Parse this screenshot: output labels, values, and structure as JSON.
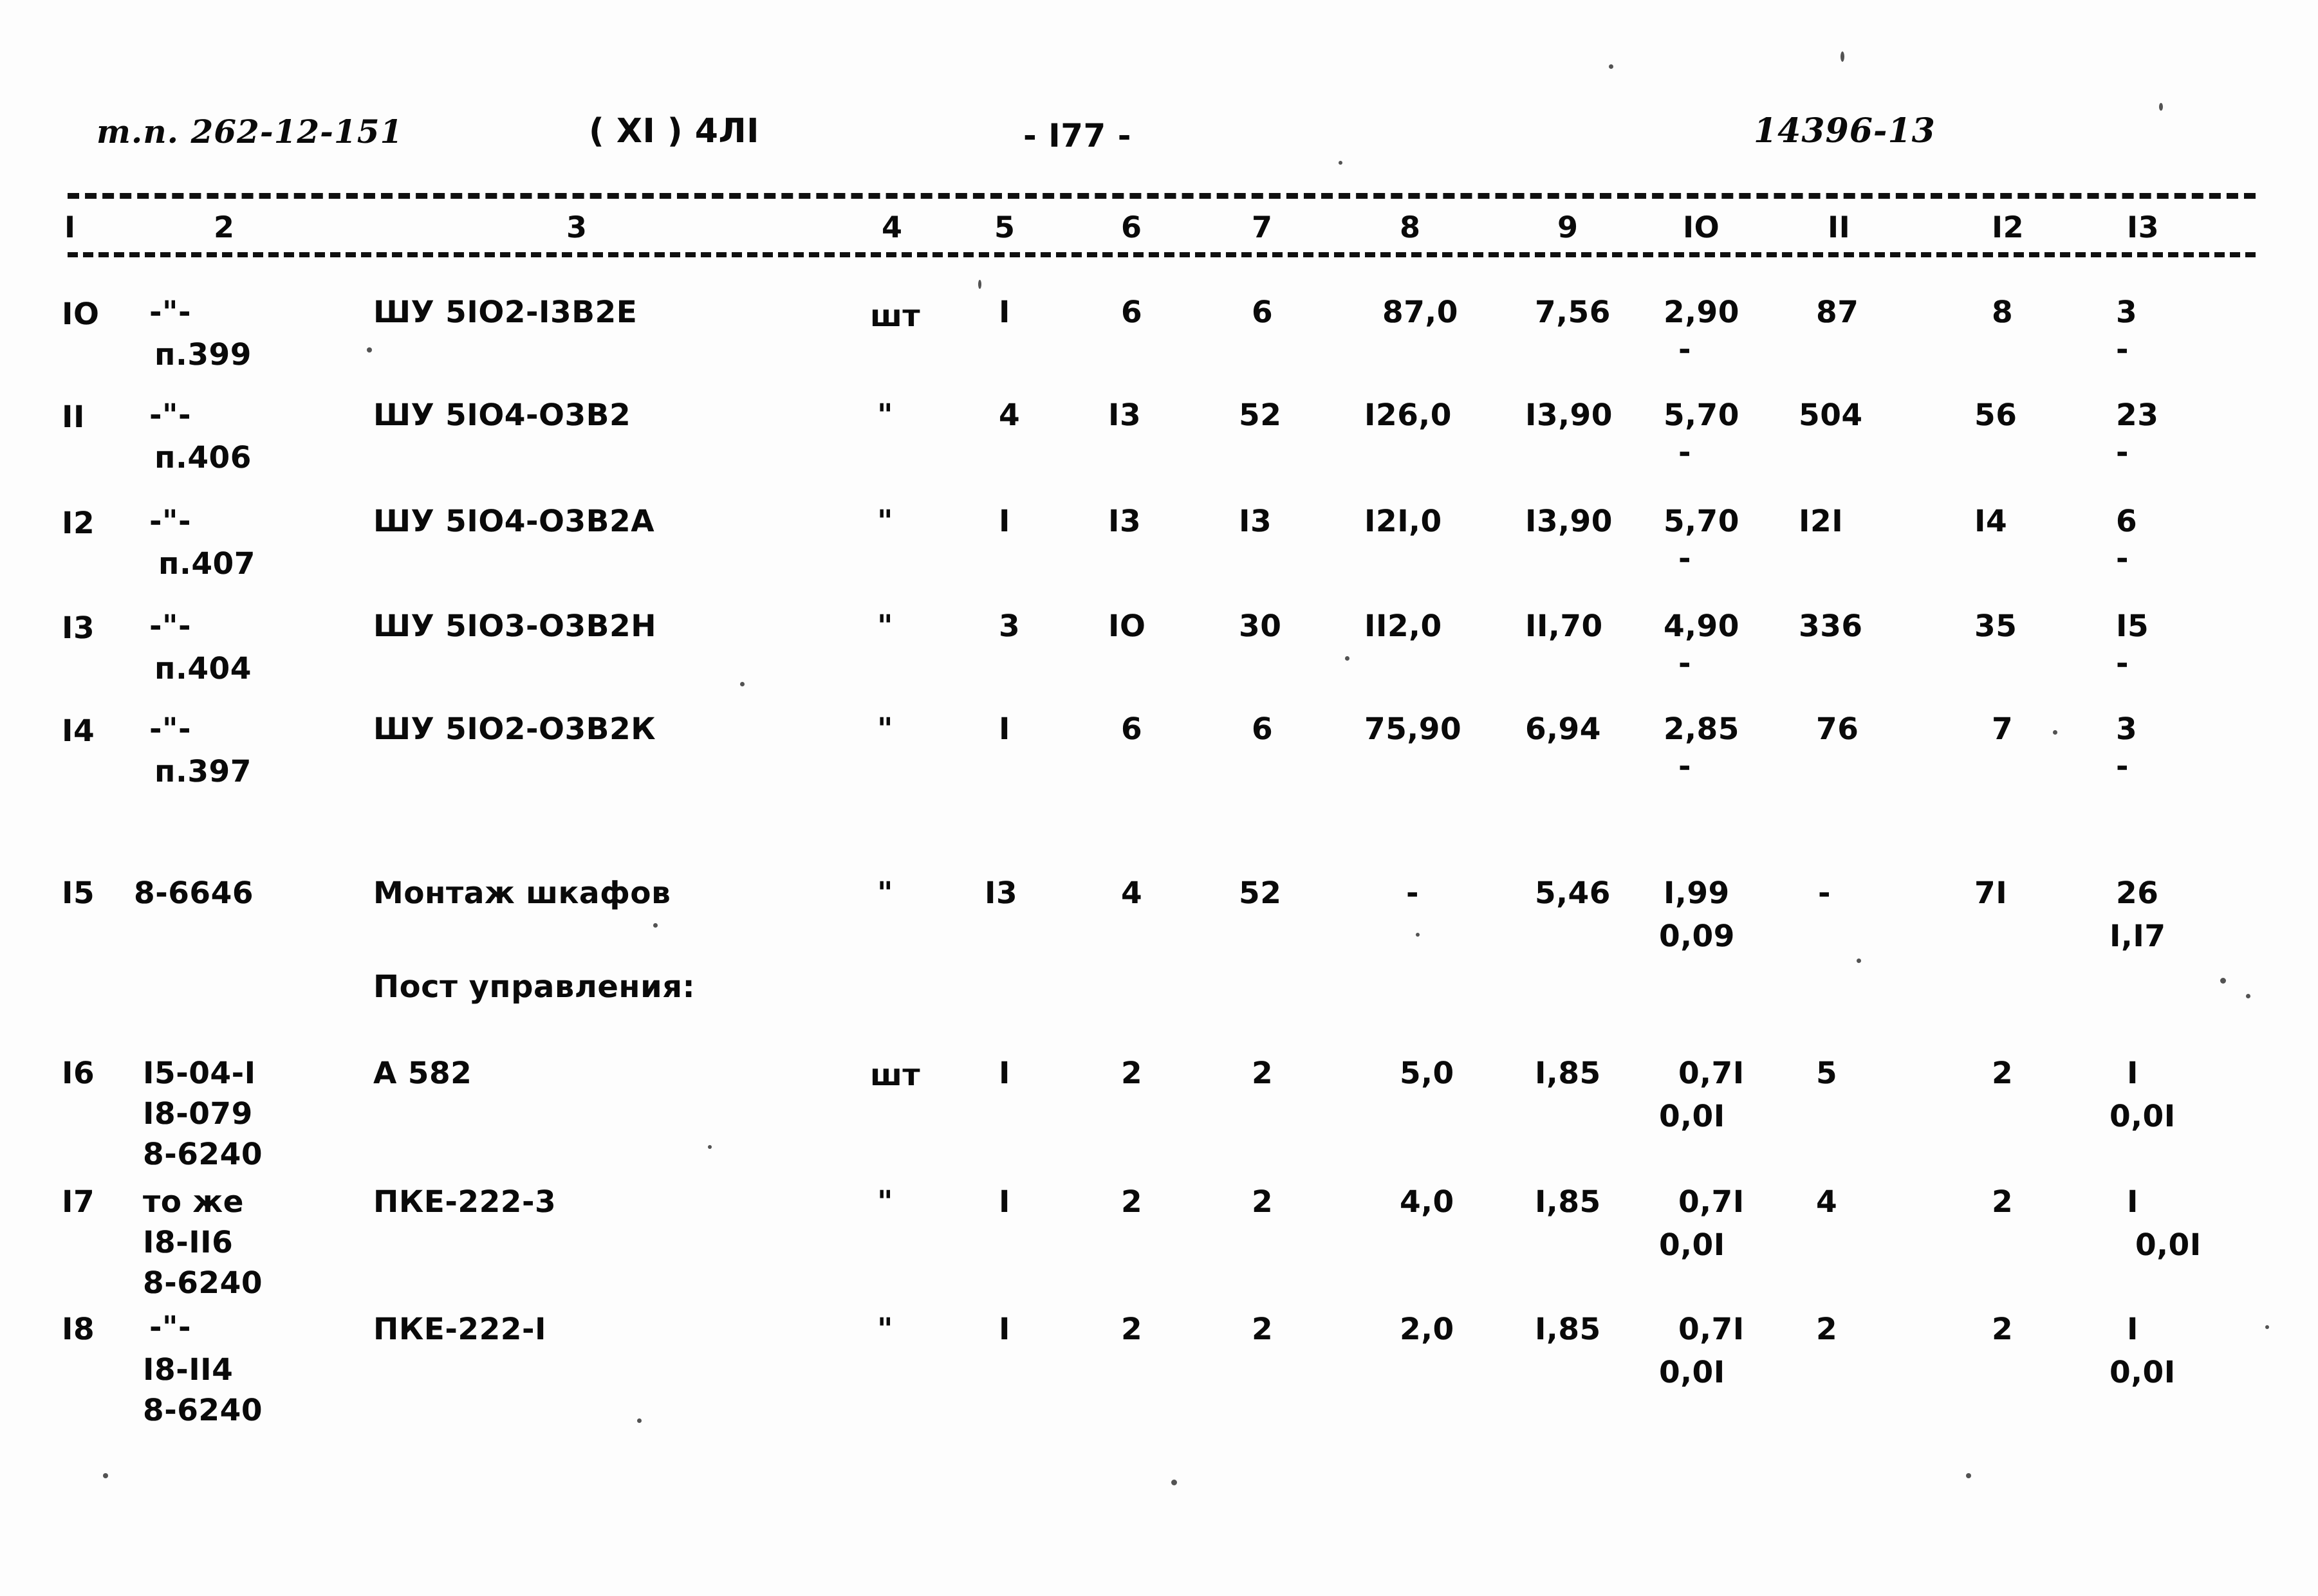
{
  "page": {
    "doc_code": "т.п. 262-12-151",
    "album": "( ХI ) 4ЛI",
    "page_number": "- I77 -",
    "stamp": "14396-13"
  },
  "table": {
    "column_headers": [
      "I",
      "2",
      "3",
      "4",
      "5",
      "6",
      "7",
      "8",
      "9",
      "IO",
      "II",
      "I2",
      "I3"
    ],
    "section_label": "Пост управления:",
    "rows": [
      {
        "c1": "IO",
        "c2_line1": "-\"-",
        "c2_line2": "п.399",
        "c3": "ШУ 5IО2-I3В2Е",
        "c4": "шт",
        "c5": "I",
        "c6": "6",
        "c7": "6",
        "c8": "87,0",
        "c9": "7,56",
        "c10": "2,90",
        "c10b": "-",
        "c11": "87",
        "c12": "8",
        "c13": "3",
        "c13b": "-"
      },
      {
        "c1": "II",
        "c2_line1": "-\"-",
        "c2_line2": "п.406",
        "c3": "ШУ 5IО4-О3В2",
        "c4": "\"",
        "c5": "4",
        "c6": "I3",
        "c7": "52",
        "c8": "I26,0",
        "c9": "I3,90",
        "c10": "5,70",
        "c10b": "-",
        "c11": "504",
        "c12": "56",
        "c13": "23",
        "c13b": "-"
      },
      {
        "c1": "I2",
        "c2_line1": "-\"-",
        "c2_line2": "п.407",
        "c3": "ШУ 5IО4-О3В2А",
        "c4": "\"",
        "c5": "I",
        "c6": "I3",
        "c7": "I3",
        "c8": "I2I,0",
        "c9": "I3,90",
        "c10": "5,70",
        "c10b": "-",
        "c11": "I2I",
        "c12": "I4",
        "c13": "6",
        "c13b": "-"
      },
      {
        "c1": "I3",
        "c2_line1": "-\"-",
        "c2_line2": "п.404",
        "c3": "ШУ 5IО3-О3В2Н",
        "c4": "\"",
        "c5": "3",
        "c6": "IO",
        "c7": "30",
        "c8": "II2,0",
        "c9": "II,70",
        "c10": "4,90",
        "c10b": "-",
        "c11": "336",
        "c12": "35",
        "c13": "I5",
        "c13b": "-"
      },
      {
        "c1": "I4",
        "c2_line1": "-\"-",
        "c2_line2": "п.397",
        "c3": "ШУ 5IО2-О3В2К",
        "c4": "\"",
        "c5": "I",
        "c6": "6",
        "c7": "6",
        "c8": "75,90",
        "c9": "6,94",
        "c10": "2,85",
        "c10b": "-",
        "c11": "76",
        "c12": "7",
        "c13": "3",
        "c13b": "-"
      },
      {
        "c1": "I5",
        "c2_line1": "8-6646",
        "c2_line2": "",
        "c3": "Монтаж шкафов",
        "c4": "\"",
        "c5": "I3",
        "c6": "4",
        "c7": "52",
        "c8": "-",
        "c9": "5,46",
        "c10": "I,99",
        "c10b": "0,09",
        "c11": "-",
        "c12": "7I",
        "c13": "26",
        "c13b": "I,I7"
      },
      {
        "c1": "I6",
        "c2_line1": "I5-04-I",
        "c2_line2": "I8-079",
        "c2_line3": "8-6240",
        "c3": "А 582",
        "c4": "шт",
        "c5": "I",
        "c6": "2",
        "c7": "2",
        "c8": "5,0",
        "c9": "I,85",
        "c10": "0,7I",
        "c10b": "0,0I",
        "c11": "5",
        "c12": "2",
        "c13": "I",
        "c13b": "0,0I"
      },
      {
        "c1": "I7",
        "c2_line1": "то же",
        "c2_line2": "I8-II6",
        "c2_line3": "8-6240",
        "c3": "ПКЕ-222-3",
        "c4": "\"",
        "c5": "I",
        "c6": "2",
        "c7": "2",
        "c8": "4,0",
        "c9": "I,85",
        "c10": "0,7I",
        "c10b": "0,0I",
        "c11": "4",
        "c12": "2",
        "c13": "I",
        "c13b": "0,0I"
      },
      {
        "c1": "I8",
        "c2_line1": "-\"-",
        "c2_line2": "I8-II4",
        "c2_line3": "8-6240",
        "c3": "ПКЕ-222-I",
        "c4": "\"",
        "c5": "I",
        "c6": "2",
        "c7": "2",
        "c8": "2,0",
        "c9": "I,85",
        "c10": "0,7I",
        "c10b": "0,0I",
        "c11": "2",
        "c12": "2",
        "c13": "I",
        "c13b": "0,0I"
      }
    ]
  }
}
